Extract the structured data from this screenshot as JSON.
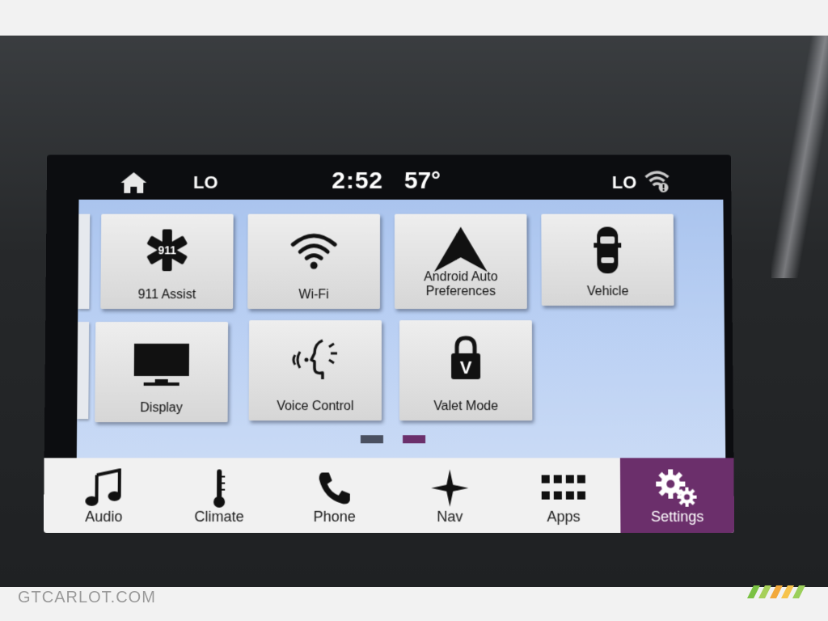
{
  "status_bar": {
    "home_icon": "home-icon",
    "climate_left": "LO",
    "time": "2:52",
    "temperature": "57°",
    "climate_right": "LO",
    "wifi_icon": "wifi-status-icon"
  },
  "tiles": [
    {
      "label": "911 Assist",
      "icon": "911-assist-icon"
    },
    {
      "label": "Wi-Fi",
      "icon": "wifi-icon"
    },
    {
      "label": "Android Auto\nPreferences",
      "icon": "android-auto-icon"
    },
    {
      "label": "Vehicle",
      "icon": "vehicle-icon"
    },
    {
      "label": "Display",
      "icon": "display-icon"
    },
    {
      "label": "Voice Control",
      "icon": "voice-control-icon"
    },
    {
      "label": "Valet Mode",
      "icon": "valet-lock-icon"
    }
  ],
  "page_indicator": {
    "count": 2,
    "active": 2
  },
  "nav": [
    {
      "label": "Audio",
      "icon": "music-note-icon"
    },
    {
      "label": "Climate",
      "icon": "thermometer-icon"
    },
    {
      "label": "Phone",
      "icon": "phone-icon"
    },
    {
      "label": "Nav",
      "icon": "compass-star-icon"
    },
    {
      "label": "Apps",
      "icon": "apps-grid-icon"
    },
    {
      "label": "Settings",
      "icon": "gears-icon",
      "active": true
    }
  ],
  "colors": {
    "accent": "#6b2f6b",
    "panel_bg": "#b6cdf2",
    "indicator_inactive": "#4a5060",
    "indicator_active": "#6b2f6b"
  },
  "watermark": "GTCARLOT.COM"
}
